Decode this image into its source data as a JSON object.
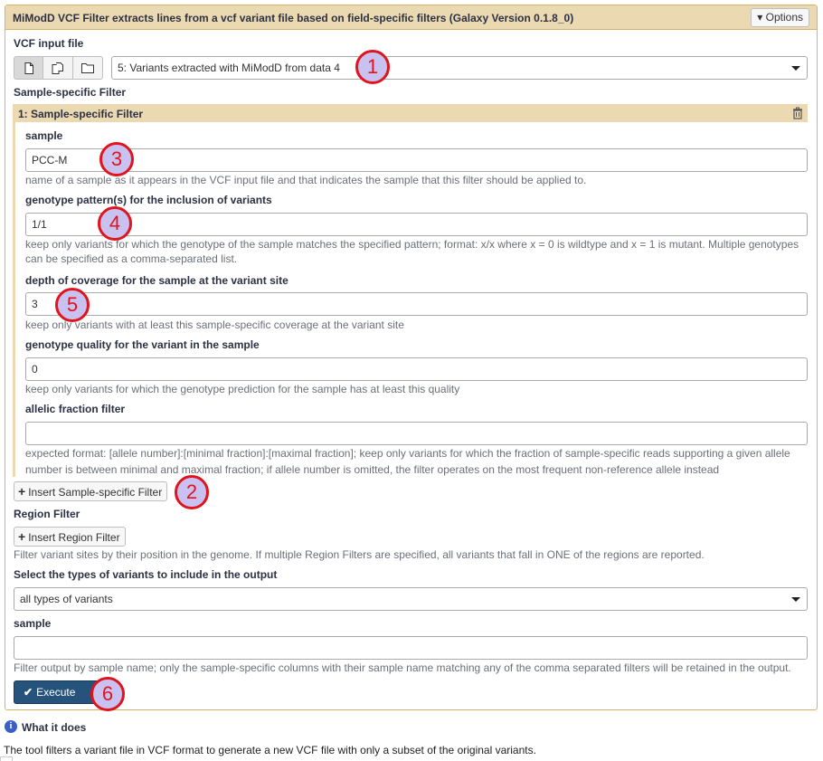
{
  "tool": {
    "title": "MiModD VCF Filter extracts lines from a vcf variant file based on field-specific filters (Galaxy Version 0.1.8_0)",
    "options_label": "Options"
  },
  "vcf_input": {
    "label": "VCF input file",
    "selected": "5: Variants extracted with MiModD from data 4",
    "icons": [
      "single-dataset-icon",
      "multiple-datasets-icon",
      "collection-folder-icon"
    ]
  },
  "sample_filter_section": {
    "label": "Sample-specific Filter",
    "repeat_title": "1: Sample-specific Filter",
    "fields": {
      "sample": {
        "label": "sample",
        "value": "PCC-M",
        "help": "name of a sample as it appears in the VCF input file and that indicates the sample that this filter should be applied to."
      },
      "genotype": {
        "label": "genotype pattern(s) for the inclusion of variants",
        "value": "1/1",
        "help_line1": "keep only variants for which the genotype of the sample matches the specified pattern; format: x/x where x = 0 is wildtype and x = 1 is mutant. Multiple genotypes",
        "help_line2": "can be specified as a comma-separated list."
      },
      "depth": {
        "label": "depth of coverage for the sample at the variant site",
        "value": "3",
        "help": "keep only variants with at least this sample-specific coverage at the variant site"
      },
      "gq": {
        "label": "genotype quality for the variant in the sample",
        "value": "0",
        "help": "keep only variants for which the genotype prediction for the sample has at least this quality"
      },
      "af": {
        "label": "allelic fraction filter",
        "value": "",
        "help_line1": "expected format: [allele number]:[minimal fraction]:[maximal fraction]; keep only variants for which the fraction of sample-specific reads supporting a given allele",
        "help_line2": "number is between minimal and maximal fraction; if allele number is omitted, the filter operates on the most frequent non-reference allele instead"
      }
    },
    "insert_button": "Insert Sample-specific Filter"
  },
  "region_filter": {
    "label": "Region Filter",
    "insert_button": "Insert Region Filter",
    "help": "Filter variant sites by their position in the genome. If multiple Region Filters are specified, all variants that fall in ONE of the regions are reported."
  },
  "variant_types": {
    "label": "Select the types of variants to include in the output",
    "selected": "all types of variants"
  },
  "output_sample": {
    "label": "sample",
    "value": "",
    "help": "Filter output by sample name; only the sample-specific columns with their sample name matching any of the comma separated filters will be retained in the output."
  },
  "execute_label": "Execute",
  "what_it_does": {
    "heading": "What it does",
    "text": "The tool filters a variant file in VCF format to generate a new VCF file with only a subset of the original variants."
  },
  "callouts": [
    "1",
    "2",
    "3",
    "4",
    "5",
    "6"
  ],
  "colors": {
    "panel_header": "#ebd9b2",
    "panel_border": "#d8b365",
    "execute_bg": "#25537b",
    "callout_ring": "#e0141c",
    "callout_fill": "#c9c2f0"
  }
}
